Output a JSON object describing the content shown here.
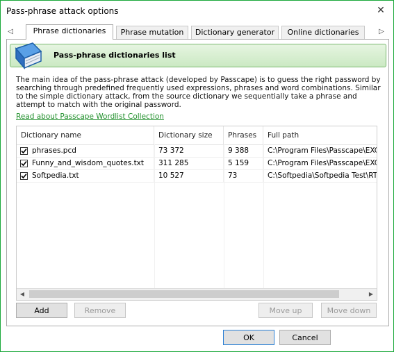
{
  "window": {
    "title": "Pass-phrase attack options",
    "close_glyph": "✕"
  },
  "tabs": [
    {
      "label": "Phrase dictionaries",
      "active": true
    },
    {
      "label": "Phrase mutation",
      "active": false
    },
    {
      "label": "Dictionary generator",
      "active": false
    },
    {
      "label": "Online dictionaries",
      "active": false
    }
  ],
  "tab_scroll": {
    "left_glyph": "◁",
    "right_glyph": "▷"
  },
  "banner": {
    "icon": "book-icon",
    "title": "Pass-phrase dictionaries list",
    "accent": "#cbe9c3"
  },
  "description": "The main idea of the pass-phrase attack (developed by Passcape) is to guess the right password by searching through predefined frequently used expressions, phrases and word combinations. Similar to the simple dictionary attack, from the source dictionary we sequentially take a phrase and attempt to match with the original password.",
  "link": {
    "label": "Read about Passcape Wordlist Collection",
    "color": "#1f8f2a"
  },
  "table": {
    "columns": [
      "Dictionary name",
      "Dictionary size",
      "Phrases",
      "Full path"
    ],
    "rows": [
      {
        "checked": true,
        "name": "phrases.pcd",
        "size": "73 372",
        "phrases": "9 388",
        "path": "C:\\Program Files\\Passcape\\EXCE"
      },
      {
        "checked": true,
        "name": "Funny_and_wisdom_quotes.txt",
        "size": "311 285",
        "phrases": "5 159",
        "path": "C:\\Program Files\\Passcape\\EXCE"
      },
      {
        "checked": true,
        "name": "Softpedia.txt",
        "size": "10 527",
        "phrases": "73",
        "path": "C:\\Softpedia\\Softpedia Test\\RTF"
      }
    ]
  },
  "scroll": {
    "left_glyph": "◀",
    "right_glyph": "▶"
  },
  "buttons": {
    "add": "Add",
    "remove": "Remove",
    "move_up": "Move up",
    "move_down": "Move down",
    "ok": "OK",
    "cancel": "Cancel"
  }
}
